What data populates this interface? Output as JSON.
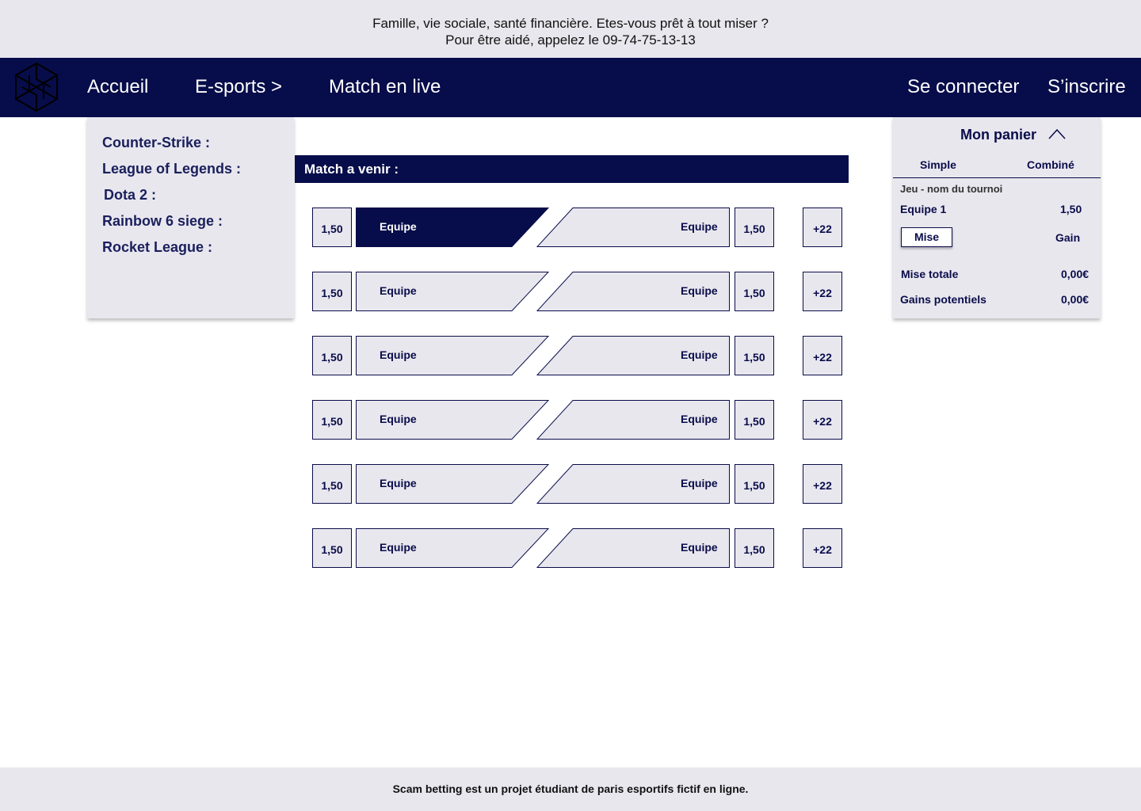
{
  "warning": {
    "line1": "Famille, vie sociale, santé financière. Etes-vous prêt à tout miser ?",
    "line2": "Pour être aidé, appelez le 09-74-75-13-13"
  },
  "nav": {
    "home": "Accueil",
    "esports": "E-sports >",
    "live": "Match en live",
    "login": "Se connecter",
    "register": "S’inscrire"
  },
  "sidebar": {
    "games": [
      "Counter-Strike :",
      "League of Legends :",
      "Dota 2 :",
      "Rainbow 6 siege :",
      "Rocket League :"
    ]
  },
  "matches": {
    "title": "Match a venir :",
    "rows": [
      {
        "odd_left": "1,50",
        "team_left": "Equipe",
        "team_right": "Equipe",
        "odd_right": "1,50",
        "more": "+22",
        "selected": "left"
      },
      {
        "odd_left": "1,50",
        "team_left": "Equipe",
        "team_right": "Equipe",
        "odd_right": "1,50",
        "more": "+22",
        "selected": ""
      },
      {
        "odd_left": "1,50",
        "team_left": "Equipe",
        "team_right": "Equipe",
        "odd_right": "1,50",
        "more": "+22",
        "selected": ""
      },
      {
        "odd_left": "1,50",
        "team_left": "Equipe",
        "team_right": "Equipe",
        "odd_right": "1,50",
        "more": "+22",
        "selected": ""
      },
      {
        "odd_left": "1,50",
        "team_left": "Equipe",
        "team_right": "Equipe",
        "odd_right": "1,50",
        "more": "+22",
        "selected": ""
      },
      {
        "odd_left": "1,50",
        "team_left": "Equipe",
        "team_right": "Equipe",
        "odd_right": "1,50",
        "more": "+22",
        "selected": ""
      }
    ]
  },
  "cart": {
    "title": "Mon panier",
    "toggle_icon": "chevron-up-icon",
    "tab_simple": "Simple",
    "tab_combined": "Combiné",
    "tournament": "Jeu - nom du tournoi",
    "team": "Equipe 1",
    "odd": "1,50",
    "stake_button": "Mise",
    "gain_label": "Gain",
    "total_stake_label": "Mise totale",
    "total_stake_value": "0,00€",
    "potential_gains_label": "Gains potentiels",
    "potential_gains_value": "0,00€"
  },
  "footer": {
    "text": "Scam betting est un projet étudiant de paris esportifs fictif en ligne."
  },
  "colors": {
    "navy": "#070d4a",
    "panel": "#e8e7ee",
    "text": "#0a0c4a"
  },
  "icons": {
    "logo": "hexagon-logo-icon"
  }
}
